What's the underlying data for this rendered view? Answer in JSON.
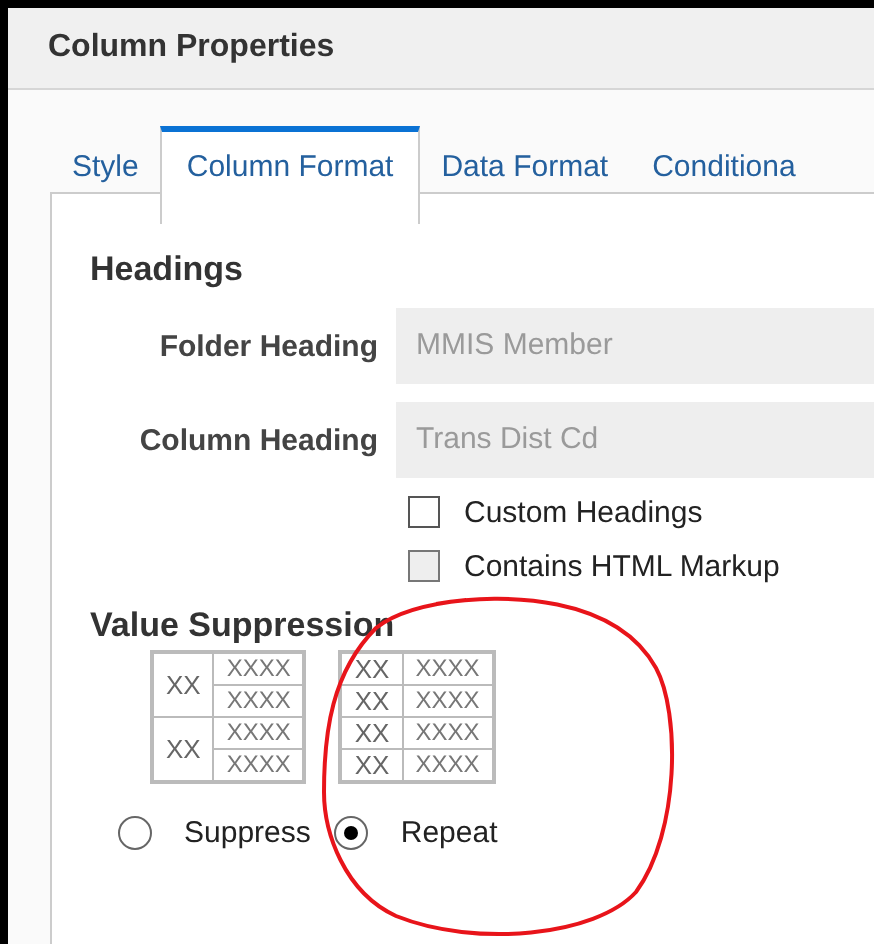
{
  "window": {
    "title": "Column Properties"
  },
  "tabs": [
    {
      "label": "Style",
      "selected": false
    },
    {
      "label": "Column Format",
      "selected": true
    },
    {
      "label": "Data Format",
      "selected": false
    },
    {
      "label": "Conditiona",
      "selected": false
    }
  ],
  "headings": {
    "title": "Headings",
    "fields": [
      {
        "label": "Folder Heading",
        "value": "MMIS Member",
        "disabled": true
      },
      {
        "label": "Column Heading",
        "value": "Trans Dist Cd",
        "disabled": true
      }
    ],
    "checkboxes": [
      {
        "label": "Custom Headings",
        "checked": false,
        "disabled": false
      },
      {
        "label": "Contains HTML Markup",
        "checked": false,
        "disabled": true
      }
    ]
  },
  "value_suppression": {
    "title": "Value Suppression",
    "options": [
      {
        "label": "Suppress",
        "selected": false,
        "preview": [
          {
            "key": "XX",
            "values": [
              "XXXX",
              "XXXX"
            ]
          },
          {
            "key": "XX",
            "values": [
              "XXXX",
              "XXXX"
            ]
          }
        ]
      },
      {
        "label": "Repeat",
        "selected": true,
        "preview": [
          {
            "key": "XX",
            "values": [
              "XXXX"
            ]
          },
          {
            "key": "XX",
            "values": [
              "XXXX"
            ]
          },
          {
            "key": "XX",
            "values": [
              "XXXX"
            ]
          },
          {
            "key": "XX",
            "values": [
              "XXXX"
            ]
          }
        ]
      }
    ]
  }
}
